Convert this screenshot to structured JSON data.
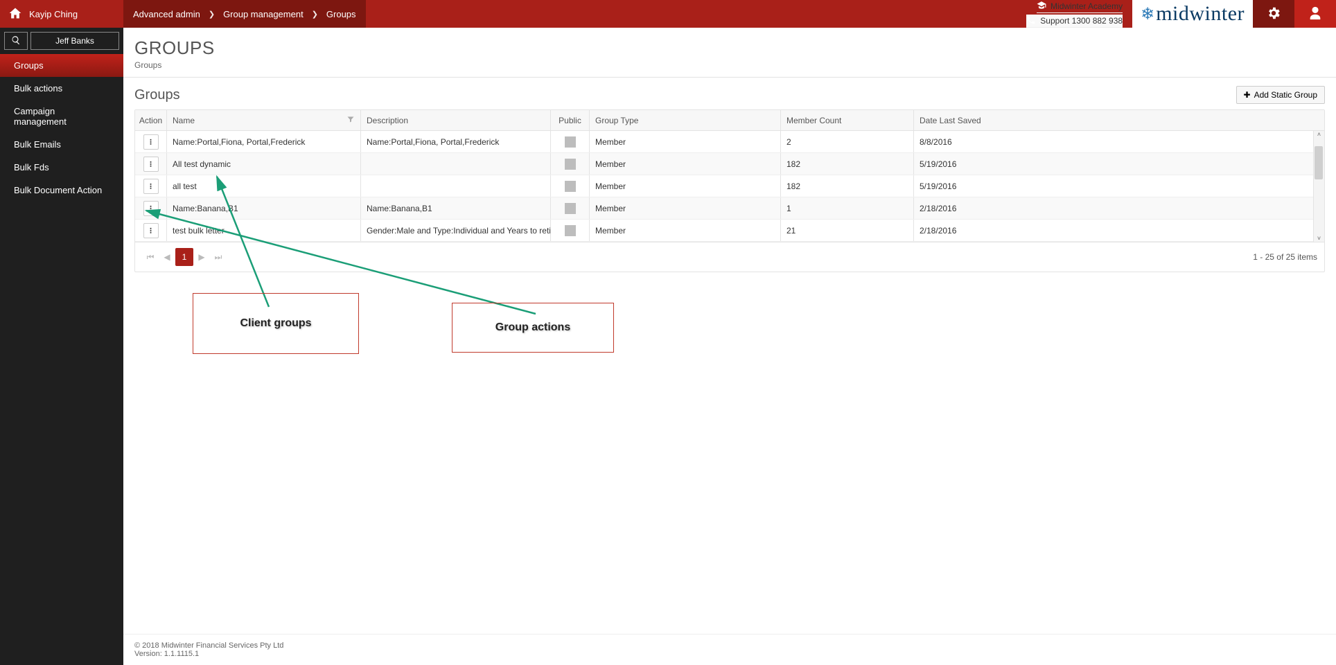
{
  "topbar": {
    "user_name": "Kayip Ching",
    "breadcrumbs": [
      {
        "label": "Advanced admin"
      },
      {
        "label": "Group management"
      },
      {
        "label": "Groups"
      }
    ],
    "academy_label": "Midwinter Academy",
    "support_label": "Support 1300 882 938",
    "brand": "midwinter"
  },
  "sidebar": {
    "client_name": "Jeff Banks",
    "items": [
      {
        "label": "Groups",
        "active": true
      },
      {
        "label": "Bulk actions"
      },
      {
        "label": "Campaign management"
      },
      {
        "label": "Bulk Emails"
      },
      {
        "label": "Bulk Fds"
      },
      {
        "label": "Bulk Document Action"
      }
    ]
  },
  "page": {
    "title": "GROUPS",
    "sub": "Groups",
    "section_title": "Groups",
    "add_button": "Add Static Group",
    "pager_info": "1 - 25 of 25 items",
    "page_num": "1"
  },
  "columns": {
    "action": "Action",
    "name": "Name",
    "description": "Description",
    "public": "Public",
    "group_type": "Group Type",
    "member_count": "Member Count",
    "date_last_saved": "Date Last Saved"
  },
  "rows": [
    {
      "name": "Name:Portal,Fiona, Portal,Frederick",
      "description": "Name:Portal,Fiona, Portal,Frederick",
      "group_type": "Member",
      "member_count": "2",
      "date": "8/8/2016"
    },
    {
      "name": "All test dynamic",
      "description": "",
      "group_type": "Member",
      "member_count": "182",
      "date": "5/19/2016"
    },
    {
      "name": "all test",
      "description": "",
      "group_type": "Member",
      "member_count": "182",
      "date": "5/19/2016"
    },
    {
      "name": "Name:Banana,B1",
      "description": "Name:Banana,B1",
      "group_type": "Member",
      "member_count": "1",
      "date": "2/18/2016"
    },
    {
      "name": "test bulk letter",
      "description": "Gender:Male and Type:Individual and Years to retireme…",
      "group_type": "Member",
      "member_count": "21",
      "date": "2/18/2016"
    }
  ],
  "annotations": {
    "box1": "Client groups",
    "box2": "Group actions"
  },
  "footer": {
    "copyright": "© 2018 Midwinter Financial Services Pty Ltd",
    "version": "Version: 1.1.1115.1"
  }
}
